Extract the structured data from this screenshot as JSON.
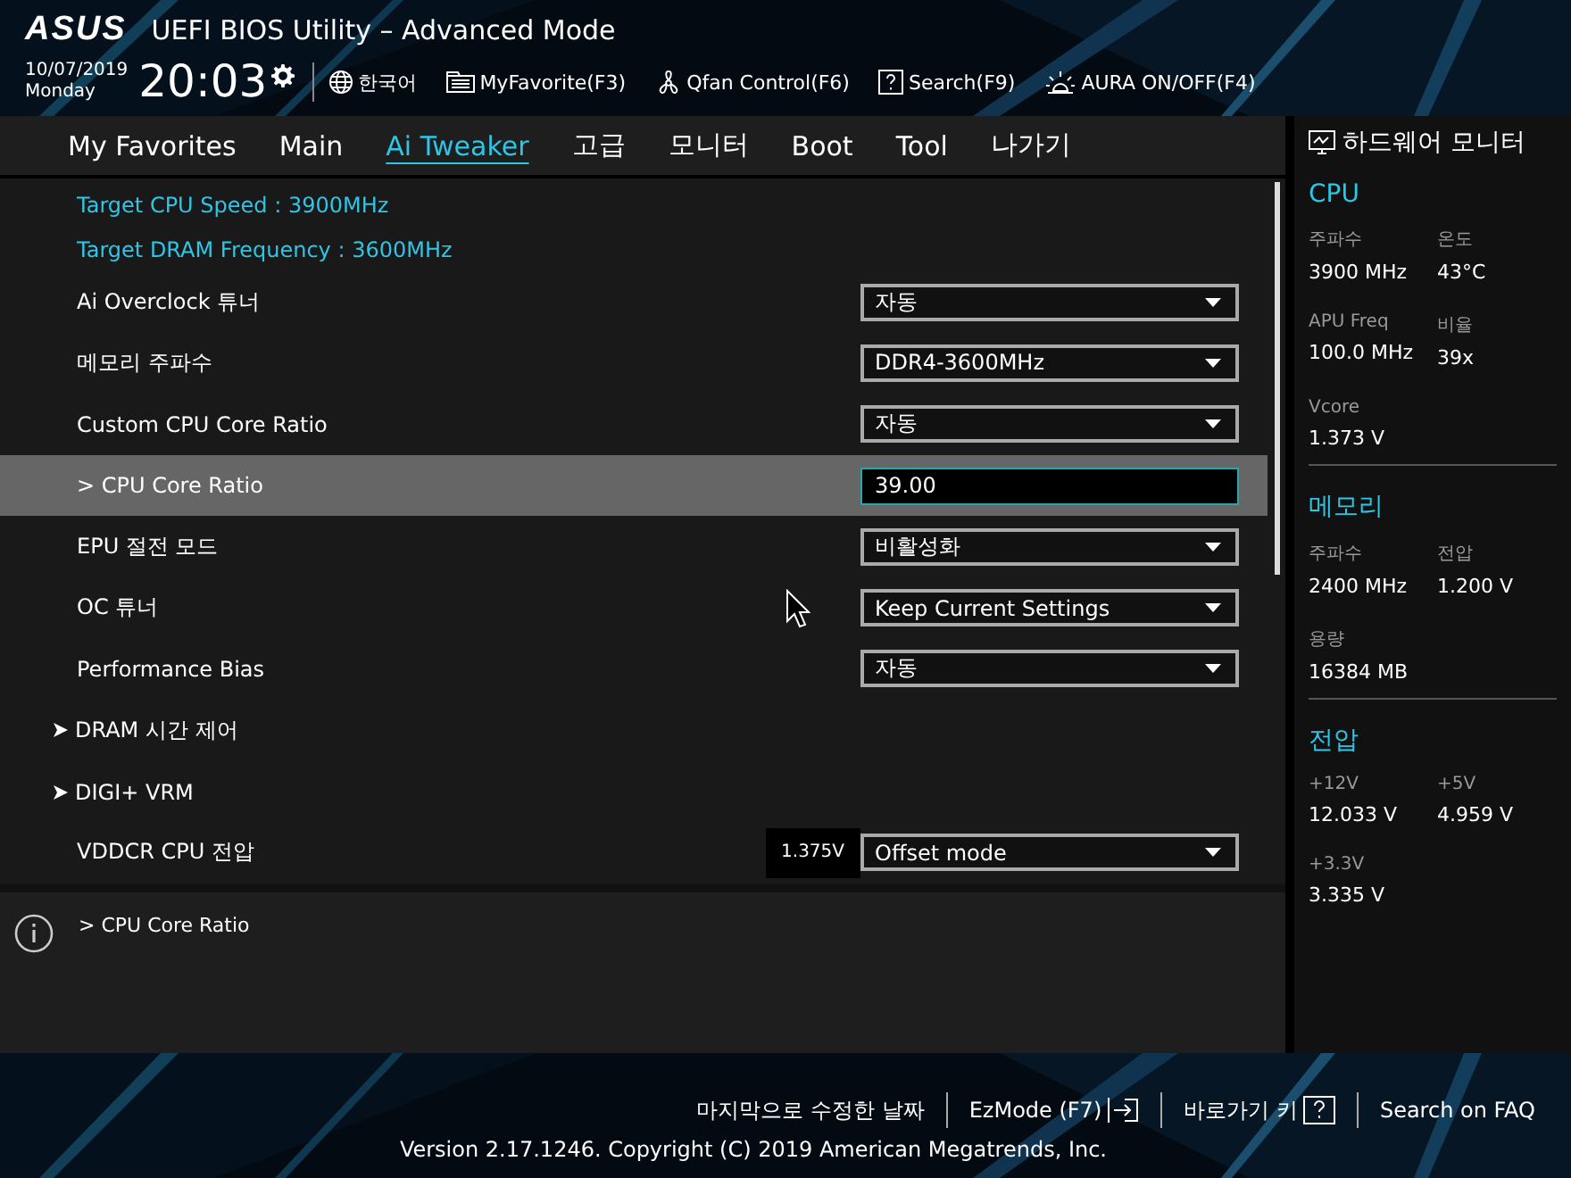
{
  "header": {
    "title": "UEFI BIOS Utility – Advanced Mode",
    "logo": "ASUS",
    "date": "10/07/2019",
    "day": "Monday",
    "time": "20:03",
    "toolbar": [
      {
        "kind": "language",
        "label": "한국어"
      },
      {
        "kind": "favorite",
        "label": "MyFavorite(F3)"
      },
      {
        "kind": "fan",
        "label": "Qfan Control(F6)"
      },
      {
        "kind": "search",
        "label": "Search(F9)"
      },
      {
        "kind": "aura",
        "label": "AURA ON/OFF(F4)"
      }
    ]
  },
  "tabs": [
    {
      "label": "My Favorites",
      "selected": false
    },
    {
      "label": "Main",
      "selected": false
    },
    {
      "label": "Ai Tweaker",
      "selected": true
    },
    {
      "label": "고급",
      "selected": false
    },
    {
      "label": "모니터",
      "selected": false
    },
    {
      "label": "Boot",
      "selected": false
    },
    {
      "label": "Tool",
      "selected": false
    },
    {
      "label": "나가기",
      "selected": false
    }
  ],
  "settings": [
    {
      "kind": "info",
      "label": "Target CPU Speed : 3900MHz",
      "selected": false
    },
    {
      "kind": "info",
      "label": "Target DRAM Frequency : 3600MHz",
      "selected": false
    },
    {
      "kind": "select",
      "label": "Ai Overclock 튜너",
      "value": "자동",
      "selected": false
    },
    {
      "kind": "select",
      "label": "메모리 주파수",
      "value": "DDR4-3600MHz",
      "selected": false
    },
    {
      "kind": "select",
      "label": "Custom CPU Core Ratio",
      "value": "자동",
      "selected": false
    },
    {
      "kind": "input",
      "label": "> CPU Core Ratio",
      "value": "39.00",
      "selected": true
    },
    {
      "kind": "select",
      "label": "EPU 절전 모드",
      "value": "비활성화",
      "selected": false
    },
    {
      "kind": "select",
      "label": "OC 튜너",
      "value": "Keep Current Settings",
      "selected": false
    },
    {
      "kind": "select",
      "label": "Performance Bias",
      "value": "자동",
      "selected": false
    },
    {
      "kind": "submenu",
      "label": "DRAM 시간 제어",
      "selected": false
    },
    {
      "kind": "submenu",
      "label": "DIGI+ VRM",
      "selected": false
    },
    {
      "kind": "select",
      "label": "VDDCR CPU 전압",
      "reading": "1.375V",
      "value": "Offset mode",
      "selected": false
    }
  ],
  "help": {
    "text": "> CPU Core Ratio"
  },
  "hardware_monitor": {
    "title": "하드웨어 모니터",
    "sections": [
      {
        "title": "CPU",
        "items": [
          {
            "label": "주파수",
            "value": "3900 MHz"
          },
          {
            "label": "온도",
            "value": "43°C"
          },
          {
            "label": "APU Freq",
            "value": "100.0 MHz"
          },
          {
            "label": "비율",
            "value": "39x"
          },
          {
            "label": "Vcore",
            "value": "1.373 V"
          }
        ]
      },
      {
        "title": "메모리",
        "items": [
          {
            "label": "주파수",
            "value": "2400 MHz"
          },
          {
            "label": "전압",
            "value": "1.200 V"
          },
          {
            "label": "용량",
            "value": "16384 MB"
          }
        ]
      },
      {
        "title": "전압",
        "items": [
          {
            "label": "+12V",
            "value": "12.033 V"
          },
          {
            "label": "+5V",
            "value": "4.959 V"
          },
          {
            "label": "+3.3V",
            "value": "3.335 V"
          }
        ]
      }
    ]
  },
  "footer": {
    "links": [
      {
        "kind": "plain",
        "label": "마지막으로 수정한 날짜"
      },
      {
        "kind": "ezmode",
        "label": "EzMode (F7)"
      },
      {
        "kind": "hotkeys",
        "label": "바로가기 키"
      },
      {
        "kind": "plain",
        "label": "Search on FAQ"
      }
    ],
    "version": "Version 2.17.1246. Copyright (C) 2019 American Megatrends, Inc."
  }
}
